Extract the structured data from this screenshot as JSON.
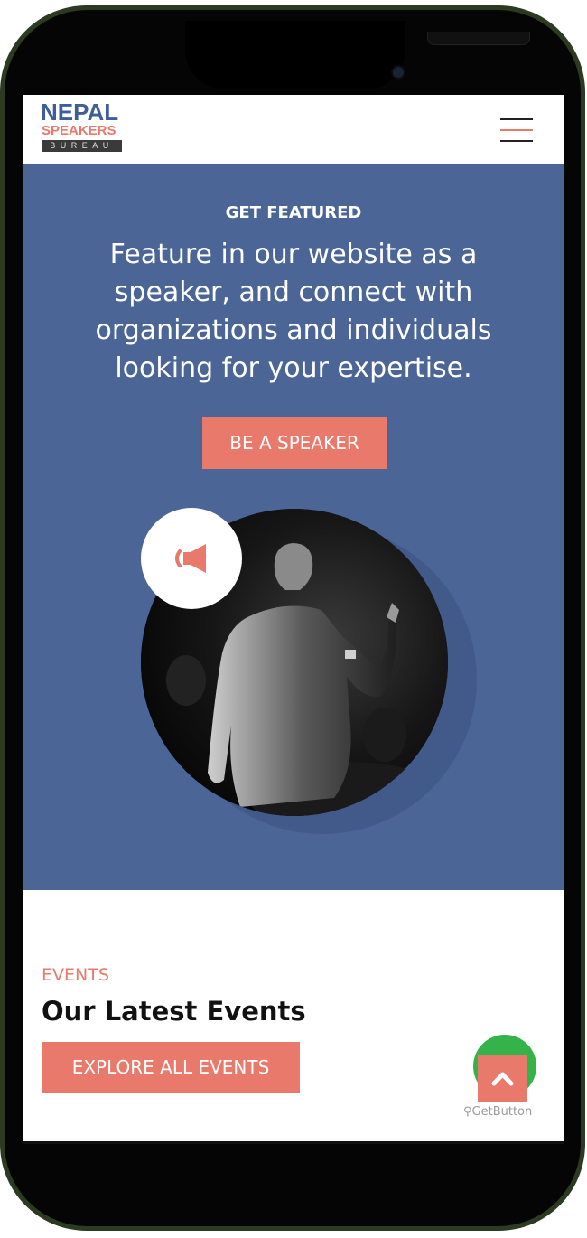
{
  "brand": {
    "line1": "NEPAL",
    "line2": "SPEAKERS",
    "line3": "BUREAU",
    "primary_color": "#3f5e98",
    "accent_color": "#e8796b"
  },
  "header": {
    "menu_icon": "hamburger-menu-icon"
  },
  "hero": {
    "eyebrow": "GET FEATURED",
    "text": "Feature in our website as a speaker, and connect with organizations and individuals looking for your expertise.",
    "cta_label": "BE A SPEAKER",
    "background_color": "#4b6597",
    "badge_icon": "megaphone-icon",
    "image": "speaker-on-stage-photo"
  },
  "events": {
    "label": "EVENTS",
    "title": "Our Latest Events",
    "button_label": "EXPLORE ALL EVENTS"
  },
  "floating": {
    "chat_icon": "whatsapp-chat-icon",
    "scroll_top_icon": "chevron-up-icon",
    "getbutton_label": "GetButton"
  }
}
